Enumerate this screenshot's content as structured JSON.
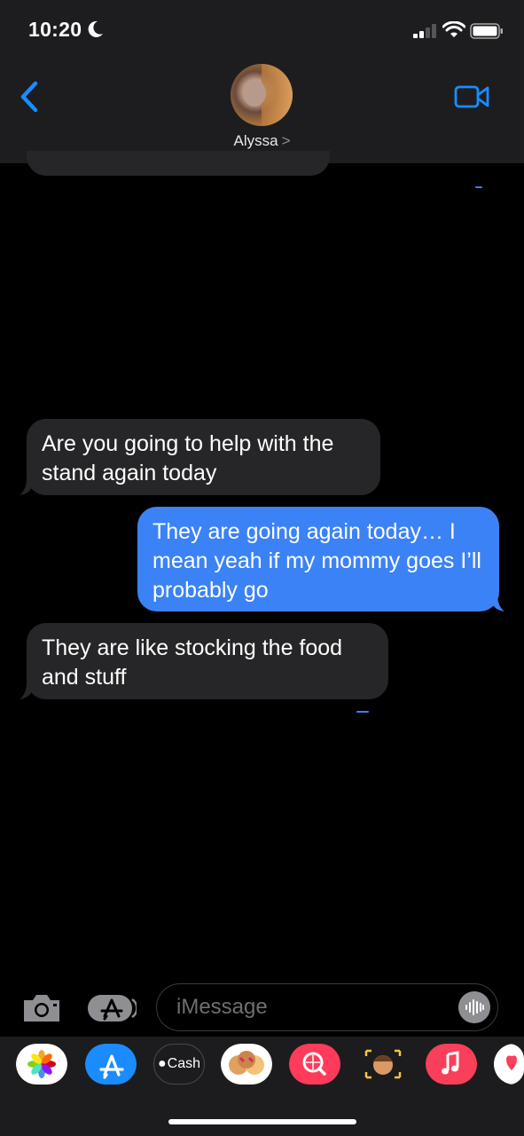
{
  "status": {
    "time": "10:20"
  },
  "header": {
    "contact_name": "Alyssa",
    "chevron": ">"
  },
  "messages": [
    {
      "direction": "incoming",
      "text": "Are you going to help with the stand again today"
    },
    {
      "direction": "outgoing",
      "text": "They are going again today… I mean yeah if my mommy goes I’ll probably go"
    },
    {
      "direction": "incoming",
      "text": "They are like stocking the food and stuff"
    }
  ],
  "composer": {
    "placeholder": "iMessage"
  },
  "app_drawer": {
    "items": [
      {
        "name": "photos-app",
        "color": "#ffffff"
      },
      {
        "name": "app-store-app",
        "color": "#1a8cff"
      },
      {
        "name": "cash-app",
        "label": "Cash",
        "color": "#1c1c1e"
      },
      {
        "name": "memoji-stickers",
        "color": "#ffffff"
      },
      {
        "name": "web-images-search",
        "color": "#ff3b5c"
      },
      {
        "name": "memoji-app",
        "color": "#1c1c1e"
      },
      {
        "name": "music-app",
        "color": "#fa3f5a"
      },
      {
        "name": "digital-touch",
        "color": "#ffffff"
      }
    ]
  },
  "colors": {
    "outgoing_bubble": "#3b82f6",
    "incoming_bubble": "#262628",
    "accent": "#1a8cff"
  }
}
